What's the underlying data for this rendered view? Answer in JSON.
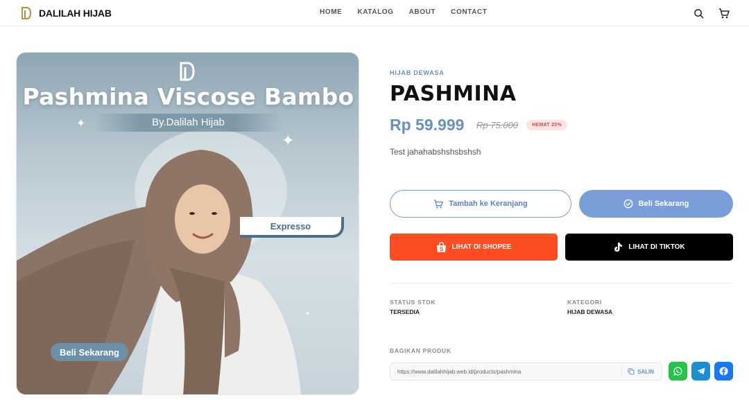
{
  "header": {
    "brand": "DALILAH HIJAB",
    "nav": [
      "HOME",
      "KATALOG",
      "ABOUT",
      "CONTACT"
    ]
  },
  "hero": {
    "title": "Pashmina Viscose Bambo",
    "subtitle": "By.Dalilah Hijab",
    "color_tag": "Expresso",
    "cta": "Beli Sekarang"
  },
  "product": {
    "category": "HIJAB DEWASA",
    "title": "PASHMINA",
    "price": "Rp 59.999",
    "old_price": "Rp 75.000",
    "discount_badge": "HEMAT 20%",
    "description": "Test jahahabshshsbshsh"
  },
  "actions": {
    "add_to_cart": "Tambah ke Keranjang",
    "buy_now": "Beli Sekarang",
    "shopee": "LIHAT DI SHOPEE",
    "tiktok": "LIHAT DI TIKTOK"
  },
  "meta": {
    "stock_label": "STATUS STOK",
    "stock_value": "TERSEDIA",
    "category_label": "KATEGORI",
    "category_value": "HIJAB DEWASA"
  },
  "share": {
    "label": "BAGIKAN PRODUK",
    "url": "https://www.dalilahhijab.web.id/products/pashmina",
    "copy_label": "SALIN"
  },
  "colors": {
    "accent": "#6b8fc4",
    "shopee": "#fe4d21",
    "tiktok": "#000000",
    "whatsapp": "#25c347",
    "telegram": "#1b8fd1",
    "facebook": "#1877f2"
  }
}
